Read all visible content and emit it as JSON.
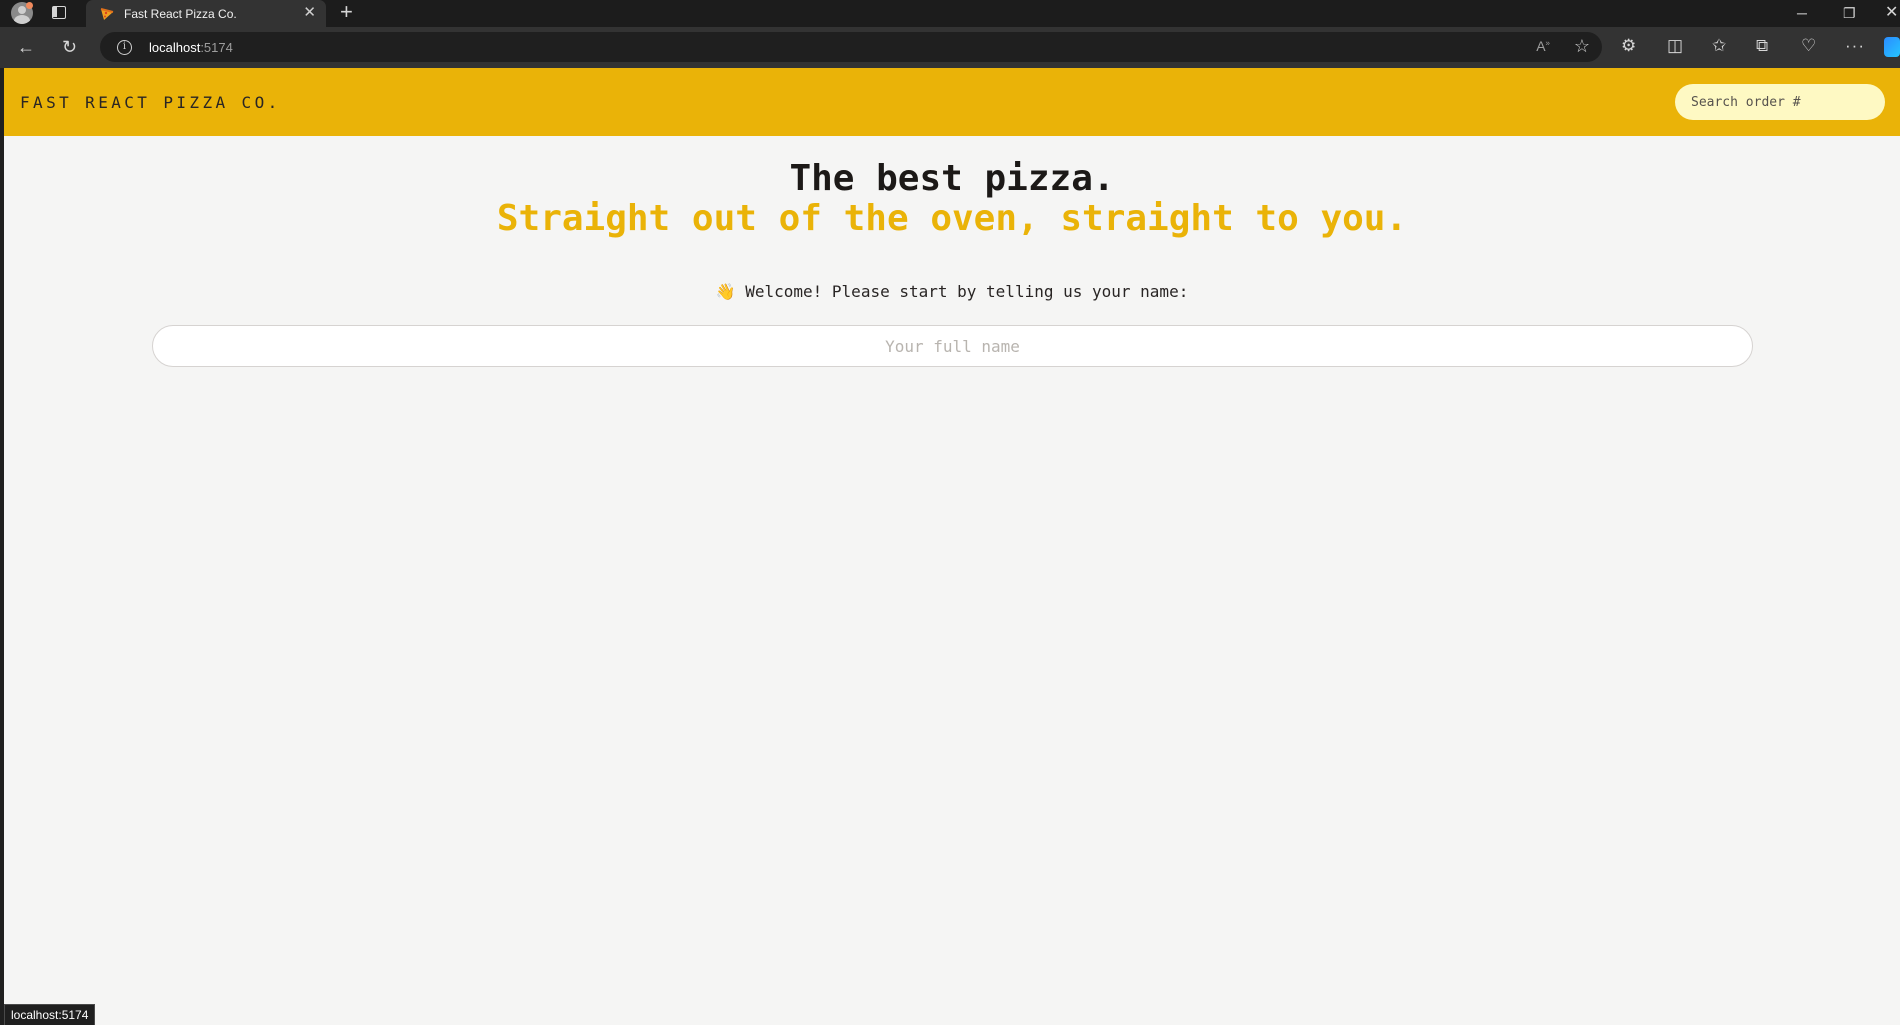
{
  "browser": {
    "tab_title": "Fast React Pizza Co.",
    "tab_close": "✕",
    "new_tab": "+",
    "url_host": "localhost",
    "url_port": ":5174",
    "window_min": "─",
    "window_max": "❐",
    "window_close": "✕",
    "status_url": "localhost:5174"
  },
  "header": {
    "logo": "Fast React Pizza Co.",
    "search_placeholder": "Search order #"
  },
  "hero": {
    "line1": "The best pizza.",
    "line2": "Straight out of the oven, straight to you."
  },
  "form": {
    "welcome_emoji": "👋",
    "welcome_text": "Welcome! Please start by telling us your name:",
    "name_placeholder": "Your full name",
    "name_value": ""
  },
  "colors": {
    "brand_yellow": "#eab308",
    "page_bg": "#f5f5f4",
    "text_dark": "#292524"
  }
}
